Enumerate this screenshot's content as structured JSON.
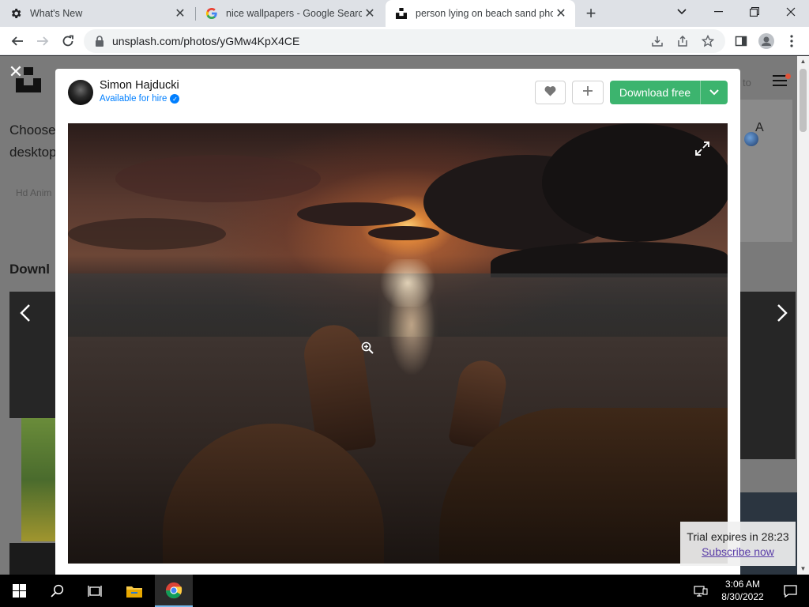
{
  "browser": {
    "tabs": [
      {
        "title": "What's New",
        "icon": "gear-icon"
      },
      {
        "title": "nice wallpapers - Google Search",
        "icon": "google-icon"
      },
      {
        "title": "person lying on beach sand phot",
        "icon": "unsplash-icon",
        "active": true
      }
    ],
    "url": "unsplash.com/photos/yGMw4KpX4CE"
  },
  "page_background": {
    "choose_text_1": "Choose",
    "choose_text_2": "desktop",
    "chip_text": "Hd Anim",
    "download_heading": "Downl",
    "top_right_partial": "to"
  },
  "modal": {
    "author": {
      "name": "Simon Hajducki",
      "status": "Available for hire",
      "verified": true
    },
    "like_icon": "heart-icon",
    "add_icon": "plus-icon",
    "download_label": "Download free",
    "download_menu_icon": "chevron-down-icon",
    "photo_alt": "person lying on beach sand photo",
    "expand_icon": "expand-icon"
  },
  "trial": {
    "text": "Trial expires in 28:23",
    "link": "Subscribe now"
  },
  "taskbar": {
    "time": "3:06 AM",
    "date": "8/30/2022"
  },
  "colors": {
    "download_green": "#3cb46e",
    "link_blue": "#007fff",
    "subscribe_purple": "#5b3ea8"
  }
}
